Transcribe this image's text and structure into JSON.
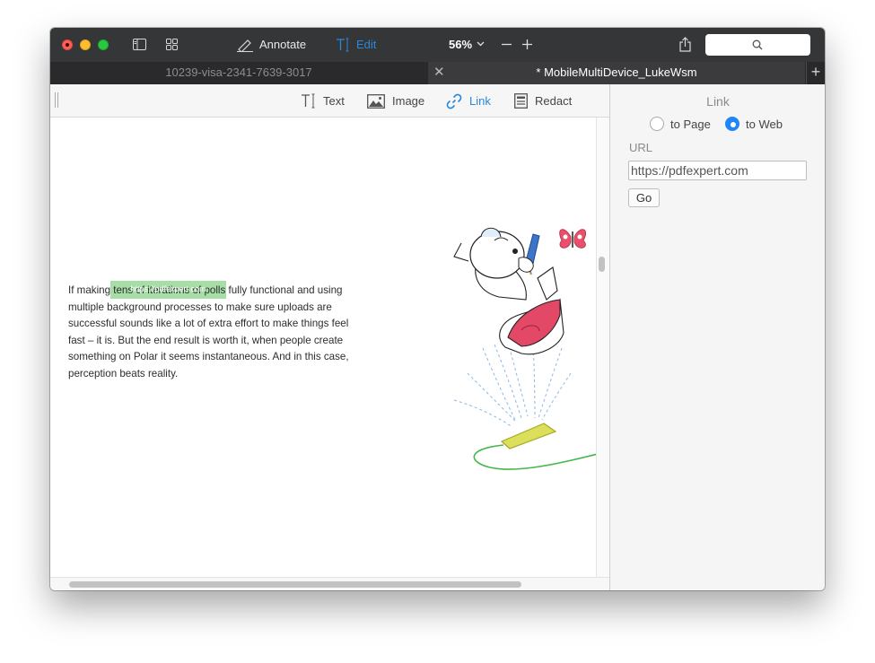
{
  "toolbar": {
    "annotate_label": "Annotate",
    "edit_label": "Edit",
    "zoom": "56%",
    "accent": "#2b87d9"
  },
  "tabs": [
    {
      "title": "10239-visa-2341-7639-3017"
    },
    {
      "title": "* MobileMultiDevice_LukeWsm"
    }
  ],
  "edit_toolbar": {
    "text_label": "Text",
    "image_label": "Image",
    "link_label": "Link",
    "redact_label": "Redact"
  },
  "document": {
    "paragraph": "If making tens of iterations of polls fully functional and using multiple background processes to make sure uploads are successful sounds like a lot of extra effort to make things feel fast – it is. But the end result is worth it, when people create something on Polar it seems instantaneous. And in this case, perception beats reality.",
    "link_tooltip": "https://pdfexpert.com"
  },
  "panel": {
    "title": "Link",
    "to_page_label": "to Page",
    "to_web_label": "to Web",
    "selected": "to Web",
    "url_label": "URL",
    "url_value": "https://pdfexpert.com",
    "go_label": "Go"
  }
}
